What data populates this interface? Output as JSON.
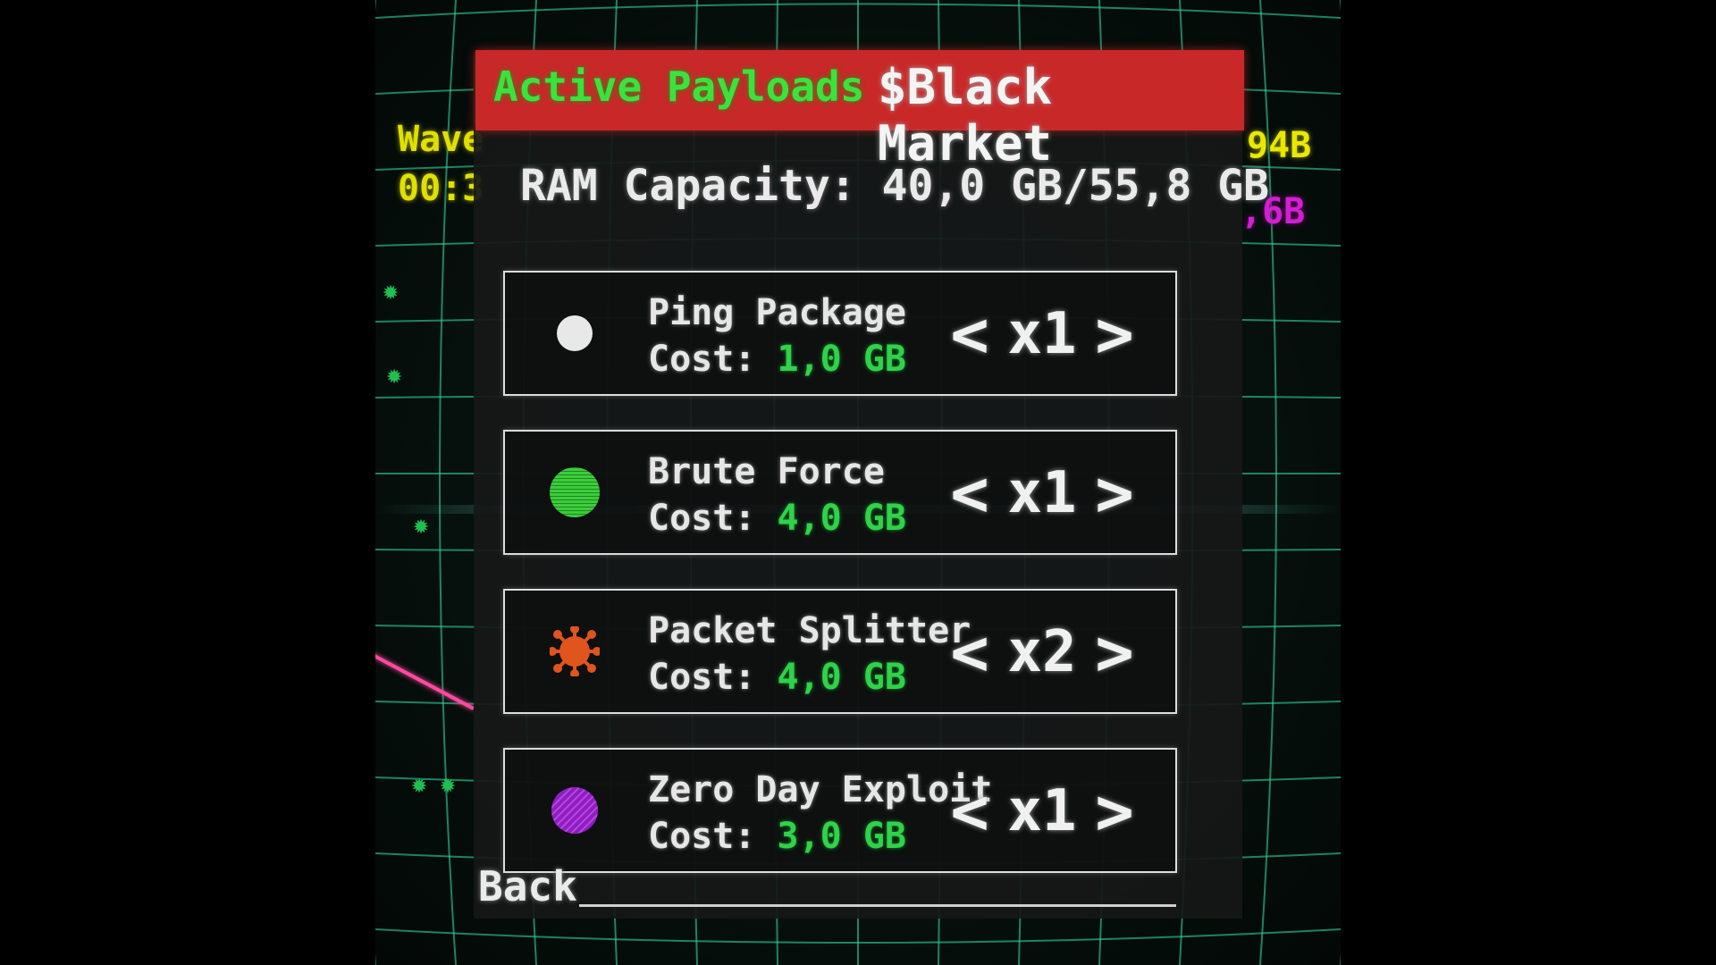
{
  "hud": {
    "wave_label": "Wave",
    "timer": "00:3",
    "bytes_right_top": "94B",
    "bytes_right_bottom": ",6B"
  },
  "tabs": {
    "active_payloads": "Active Payloads",
    "black_market": "$Black Market"
  },
  "ram": {
    "label": "RAM Capacity: 40,0 GB/55,8 GB"
  },
  "items": [
    {
      "name": "Ping Package",
      "cost_label": "Cost: ",
      "cost_value": "1,0 GB",
      "quantity": "x1",
      "icon": "white-dot-icon",
      "color": "#e8e8e8"
    },
    {
      "name": "Brute Force",
      "cost_label": "Cost: ",
      "cost_value": "4,0 GB",
      "quantity": "x1",
      "icon": "green-circle-icon",
      "color": "#3ccc3c"
    },
    {
      "name": "Packet Splitter",
      "cost_label": "Cost: ",
      "cost_value": "4,0 GB",
      "quantity": "x2",
      "icon": "orange-virus-icon",
      "color": "#e0541e"
    },
    {
      "name": "Zero Day Exploit",
      "cost_label": "Cost: ",
      "cost_value": "3,0 GB",
      "quantity": "x1",
      "icon": "purple-striped-circle-icon",
      "color": "#a030d0"
    }
  ],
  "controls": {
    "decrease": "<",
    "increase": ">",
    "back": "Back"
  },
  "colors": {
    "tab_bar": "#c82828",
    "active_tab_text": "#3ce23c",
    "cost_value": "#2fd24a",
    "grid": "#2fd4a0"
  }
}
